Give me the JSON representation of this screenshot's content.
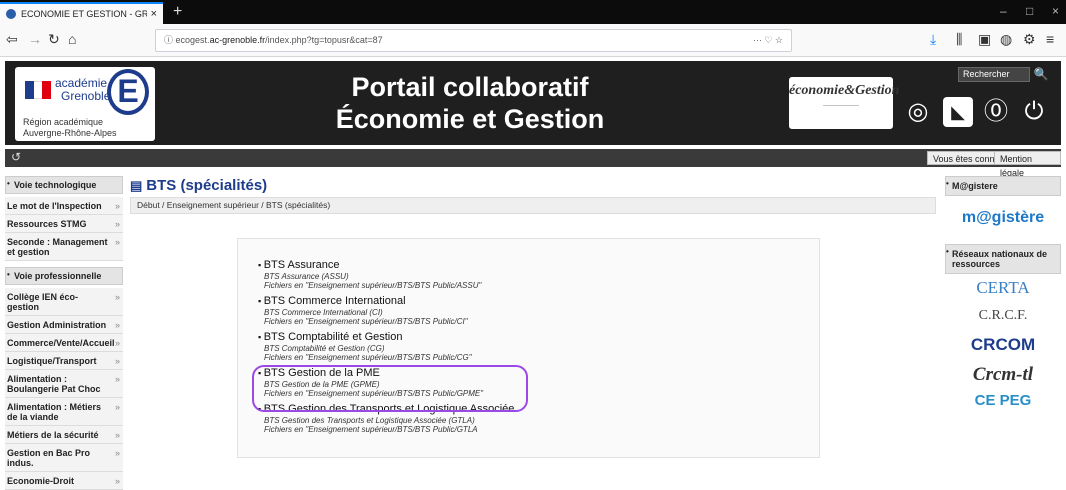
{
  "browser": {
    "tab_title": "ECONOMIE ET GESTION - GRE",
    "tab_close": "×",
    "new_tab": "+",
    "url_prefix": "ecogest.",
    "url_domain": "ac-grenoble.fr",
    "url_path": "/index.php?tg=topusr&cat=87",
    "url_actions": "··· ♡ ☆"
  },
  "header": {
    "logo_line1": "académie",
    "logo_line2": "Grenoble",
    "logo_letter": "E",
    "region_line1": "Région académique",
    "region_line2": "Auvergne-Rhône-Alpes",
    "title_line1": "Portail collaboratif",
    "title_line2": "Économie et Gestion",
    "partner_logo": "économie&Gestion",
    "search_placeholder": "Rechercher"
  },
  "infobar": {
    "connected": "Vous êtes connecté",
    "legal": "Mention légale"
  },
  "left_nav": {
    "section1": "Voie technologique",
    "items1": [
      "Le mot de l'Inspection",
      "Ressources STMG",
      "Seconde : Management et gestion"
    ],
    "section2": "Voie professionnelle",
    "items2": [
      "Collège IEN éco-gestion",
      "Gestion Administration",
      "Commerce/Vente/Accueil",
      "Logistique/Transport",
      "Alimentation : Boulangerie Pat Choc",
      "Alimentation : Métiers de la viande",
      "Métiers de la sécurité",
      "Gestion en Bac Pro indus.",
      "Economie-Droit"
    ]
  },
  "main": {
    "title": "BTS (spécialités)",
    "breadcrumb": "Début /  Enseignement supérieur /  BTS (spécialités)",
    "bts": [
      {
        "name": "BTS Assurance",
        "line1": "BTS Assurance (ASSU)",
        "line2": "Fichiers en \"Enseignement supérieur/BTS/BTS Public/ASSU\""
      },
      {
        "name": "BTS Commerce International",
        "line1": "BTS Commerce International (CI)",
        "line2": "Fichiers en \"Enseignement supérieur/BTS/BTS Public/CI\""
      },
      {
        "name": "BTS Comptabilité et Gestion",
        "line1": "BTS Comptabilité et Gestion (CG)",
        "line2": "Fichiers en \"Enseignement supérieur/BTS/BTS Public/CG\""
      },
      {
        "name": "BTS Gestion de la PME",
        "line1": "BTS Gestion de la PME (GPME)",
        "line2": "Fichiers en \"Enseignement supérieur/BTS/BTS Public/GPME\""
      },
      {
        "name": "BTS Gestion des Transports et Logistique Associée",
        "line1": "BTS Gestion des Transports et Logistique Associée (GTLA)",
        "line2": "Fichiers en \"Enseignement supérieur/BTS/BTS Public/GTLA"
      }
    ]
  },
  "right_nav": {
    "section1": "M@gistere",
    "magistere": "m@gistère",
    "section2": "Réseaux nationaux de ressources",
    "logos": [
      "CERTA",
      "C.R.C.F.",
      "CRCOM",
      "Crcm-tl",
      "CE PEG"
    ]
  },
  "colors": {
    "accent": "#1e3c8c",
    "highlight": "#9b48e6",
    "banner": "#1f1f1f"
  }
}
